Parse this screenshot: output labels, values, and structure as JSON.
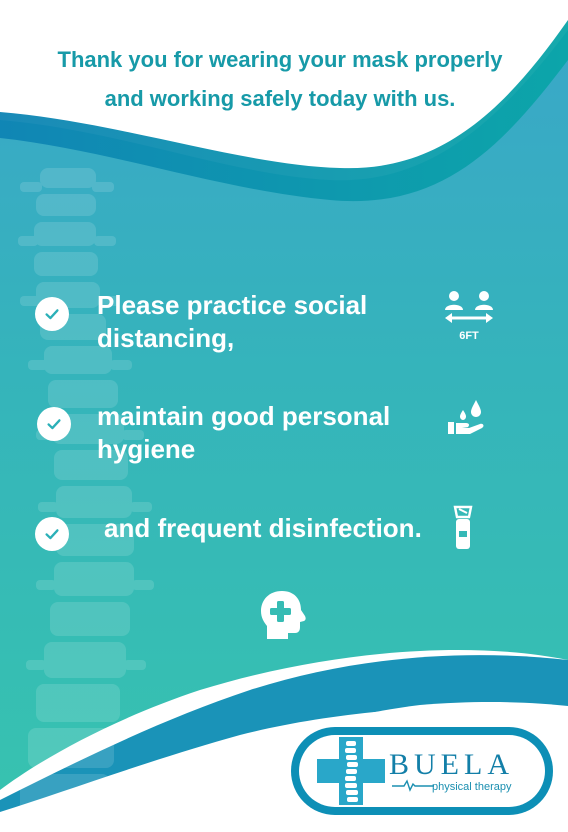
{
  "headline": {
    "line1": "Thank you for wearing your mask properly",
    "line2": "and working safely today with us."
  },
  "items": [
    {
      "line1": "Please practice social",
      "line2": "distancing,",
      "icon": "social-distancing-6ft-icon"
    },
    {
      "line1": "maintain good personal",
      "line2": "hygiene",
      "icon": "handwashing-icon"
    },
    {
      "line1": "and frequent disinfection.",
      "icon": "disinfectant-bottle-icon"
    }
  ],
  "distance_label": "6FT",
  "bottom_icon": "head-health-cross-icon",
  "logo": {
    "name": "BUELA",
    "subtitle": "physical therapy"
  },
  "colors": {
    "teal_dark": "#179aa8",
    "gradient_top": "#38a9c6",
    "gradient_bottom": "#36c0b3",
    "accent_blue": "#0d8fb6",
    "white": "#ffffff"
  }
}
